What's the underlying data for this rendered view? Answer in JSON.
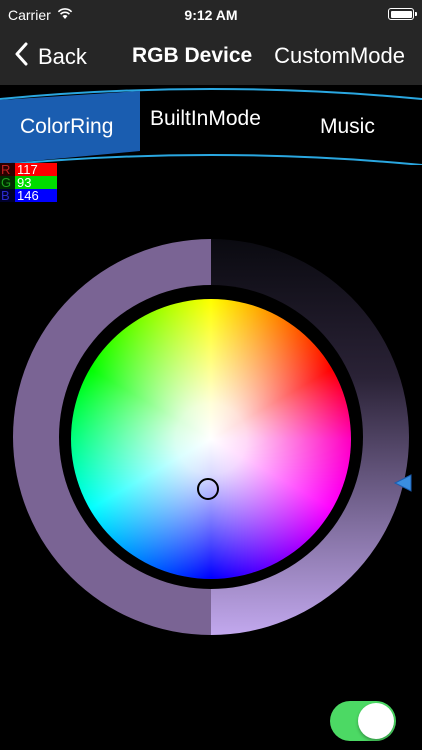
{
  "status_bar": {
    "carrier": "Carrier",
    "time": "9:12 AM"
  },
  "nav": {
    "back_label": "Back",
    "title": "RGB Device",
    "right_label": "CustomMode"
  },
  "tabs": [
    {
      "label": "ColorRing",
      "selected": true
    },
    {
      "label": "BuiltInMode",
      "selected": false
    },
    {
      "label": "Music",
      "selected": false
    }
  ],
  "rgb": {
    "r_label": "R",
    "r_value": "117",
    "g_label": "G",
    "g_value": "93",
    "b_label": "B",
    "b_value": "146"
  },
  "selected_color": "#755d92",
  "brightness_ring_color": "#7a6494",
  "toggle": {
    "on": true,
    "color": "#4cd964"
  },
  "accent": "#1a5db0"
}
